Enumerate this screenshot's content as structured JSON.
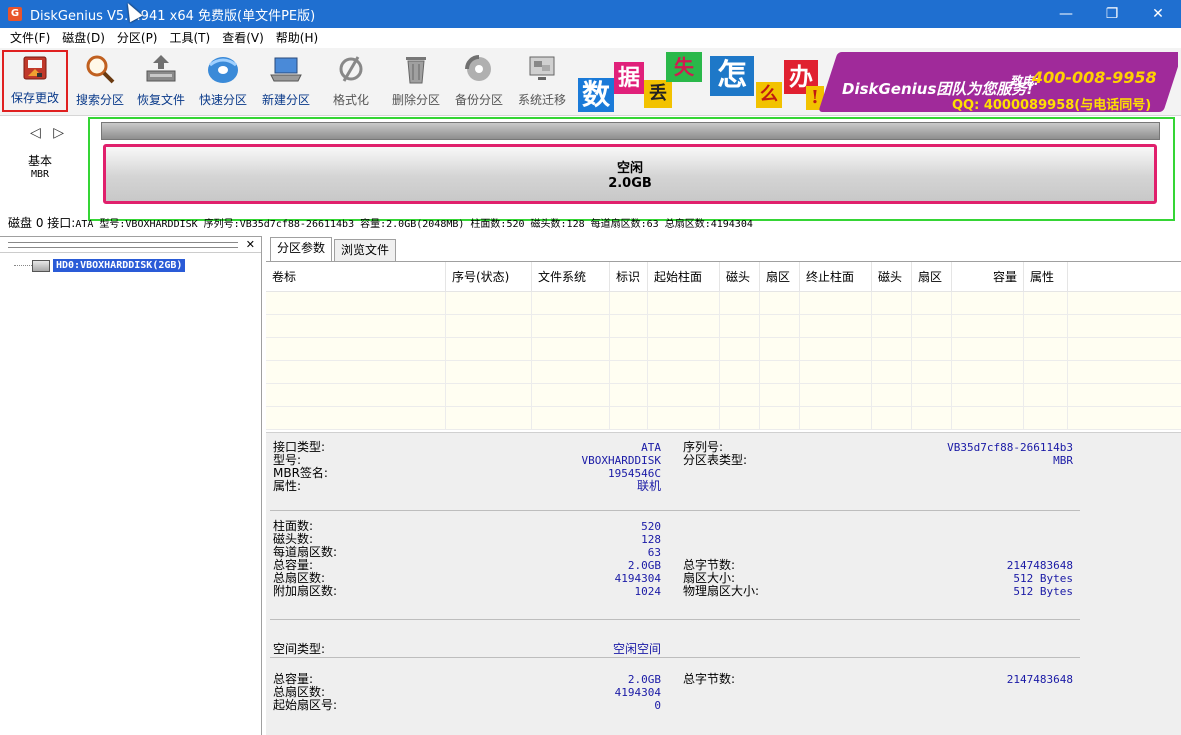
{
  "window": {
    "title": "DiskGenius V5.  .941 x64 免费版(单文件PE版)",
    "min": "—",
    "max": "❐",
    "close": "✕"
  },
  "menu": [
    "文件(F)",
    "磁盘(D)",
    "分区(P)",
    "工具(T)",
    "查看(V)",
    "帮助(H)"
  ],
  "toolbar": {
    "save": "保存更改",
    "search": "搜索分区",
    "recover": "恢复文件",
    "quick": "快速分区",
    "new": "新建分区",
    "format": "格式化",
    "delete": "删除分区",
    "backup": "备份分区",
    "migrate": "系统迁移"
  },
  "banner": {
    "chars": [
      "数",
      "据",
      "丢",
      "失",
      "怎",
      "么",
      "办",
      "!"
    ],
    "band_title": "DiskGenius团队为您服务!",
    "phone_label": "致电:",
    "phone": "400-008-9958",
    "qq": "QQ: 4000089958(与电话同号)"
  },
  "diskmap": {
    "arrows": "◁ ▷",
    "type1": "基本",
    "type2": "MBR",
    "part_label": "空闲",
    "part_size": "2.0GB",
    "info_prefix": "磁盘 0 接口:",
    "info_rest": "ATA  型号:VBOXHARDDISK  序列号:VB35d7cf88-266114b3  容量:2.0GB(2048MB)  柱面数:520  磁头数:128  每道扇区数:63  总扇区数:4194304"
  },
  "tree": {
    "node": "HD0:VBOXHARDDISK(2GB)"
  },
  "tabs": [
    "分区参数",
    "浏览文件"
  ],
  "table": {
    "headers": [
      "卷标",
      "序号(状态)",
      "文件系统",
      "标识",
      "起始柱面",
      "磁头",
      "扇区",
      "终止柱面",
      "磁头",
      "扇区",
      "容量",
      "属性"
    ]
  },
  "details": {
    "s1": {
      "iface_label": "接口类型:",
      "iface": "ATA",
      "model_label": "型号:",
      "model": "VBOXHARDDISK",
      "mbr_label": "MBR签名:",
      "mbr": "1954546C",
      "attr_label": "属性:",
      "attr": "联机",
      "serial_label": "序列号:",
      "serial": "VB35d7cf88-266114b3",
      "pt_label": "分区表类型:",
      "pt": "MBR"
    },
    "s2": {
      "cyl_label": "柱面数:",
      "cyl": "520",
      "heads_label": "磁头数:",
      "heads": "128",
      "spt_label": "每道扇区数:",
      "spt": "63",
      "cap_label": "总容量:",
      "cap": "2.0GB",
      "sec_label": "总扇区数:",
      "sec": "4194304",
      "extra_label": "附加扇区数:",
      "extra": "1024",
      "bytes_label": "总字节数:",
      "bytes": "2147483648",
      "ss_label": "扇区大小:",
      "ss": "512 Bytes",
      "pss_label": "物理扇区大小:",
      "pss": "512 Bytes"
    },
    "s3": {
      "type_label": "空间类型:",
      "type": "空闲空间"
    },
    "s4": {
      "cap_label": "总容量:",
      "cap": "2.0GB",
      "sec_label": "总扇区数:",
      "sec": "4194304",
      "start_label": "起始扇区号:",
      "start": "0",
      "bytes_label": "总字节数:",
      "bytes": "2147483648"
    }
  }
}
